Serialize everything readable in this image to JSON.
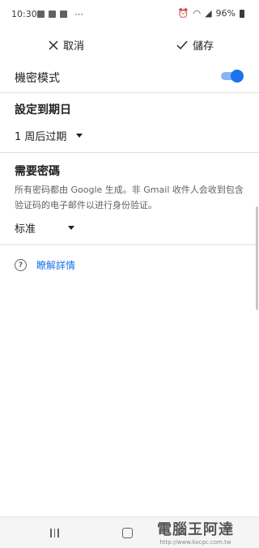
{
  "status_bar": {
    "time": "10:30",
    "more": "⋯",
    "battery": "96%"
  },
  "topbar": {
    "cancel_label": "取消",
    "save_label": "儲存"
  },
  "confidential": {
    "label": "機密模式",
    "enabled": true
  },
  "expiry": {
    "title": "設定到期日",
    "selected": "1 周后过期"
  },
  "passcode": {
    "title": "需要密碼",
    "description": "所有密码都由 Google 生成。非 Gmail 收件人会收到包含验证码的电子邮件以进行身份验证。",
    "selected": "标准"
  },
  "learn_more": {
    "label": "瞭解詳情"
  },
  "watermark": {
    "text": "電腦王阿達",
    "url": "http://www.kocpc.com.tw"
  }
}
